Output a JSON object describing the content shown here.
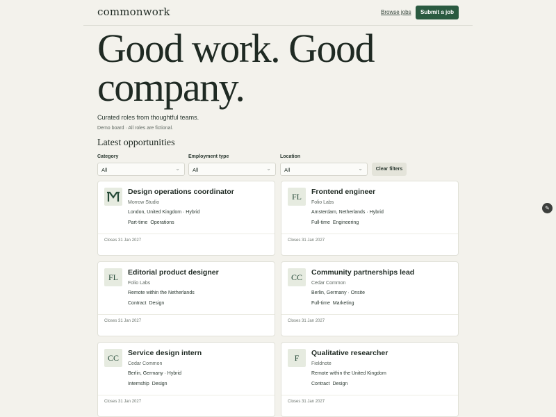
{
  "header": {
    "logo": "commonwork",
    "browse_label": "Browse jobs",
    "submit_label": "Submit a job"
  },
  "hero": {
    "line1": "Good work. Good",
    "line2": "company.",
    "subtitle": "Curated roles from thoughtful teams.",
    "note": "Demo board · All roles are fictional."
  },
  "section_title": "Latest opportunities",
  "filters": {
    "category": {
      "label": "Category",
      "value": "All"
    },
    "employment": {
      "label": "Employment type",
      "value": "All"
    },
    "location": {
      "label": "Location",
      "value": "All"
    },
    "clear_label": "Clear filters"
  },
  "jobs": [
    {
      "logo": "M",
      "title": "Design operations coordinator",
      "company": "Morrow Studio",
      "location": "London, United Kingdom · Hybrid",
      "type": "Part-time",
      "category": "Operations",
      "closes": "Closes 31 Jan 2027"
    },
    {
      "logo": "FL",
      "title": "Frontend engineer",
      "company": "Folio Labs",
      "location": "Amsterdam, Netherlands · Hybrid",
      "type": "Full-time",
      "category": "Engineering",
      "closes": "Closes 31 Jan 2027"
    },
    {
      "logo": "FL",
      "title": "Editorial product designer",
      "company": "Folio Labs",
      "location": "Remote within the Netherlands",
      "type": "Contract",
      "category": "Design",
      "closes": "Closes 31 Jan 2027"
    },
    {
      "logo": "CC",
      "title": "Community partnerships lead",
      "company": "Cedar Common",
      "location": "Berlin, Germany · Onsite",
      "type": "Full-time",
      "category": "Marketing",
      "closes": "Closes 31 Jan 2027"
    },
    {
      "logo": "CC",
      "title": "Service design intern",
      "company": "Cedar Common",
      "location": "Berlin, Germany · Hybrid",
      "type": "Internship",
      "category": "Design",
      "closes": "Closes 31 Jan 2027"
    },
    {
      "logo": "F",
      "title": "Qualitative researcher",
      "company": "Fieldnote",
      "location": "Remote within the United Kingdom",
      "type": "Contract",
      "category": "Design",
      "closes": "Closes 31 Jan 2027"
    }
  ],
  "icons": {
    "edit": "pencil-icon",
    "chevron": "chevron-down-icon"
  },
  "colors": {
    "accent": "#2a5a40",
    "background": "#f3f2ec",
    "logo_tile": "#e6ebe0"
  }
}
